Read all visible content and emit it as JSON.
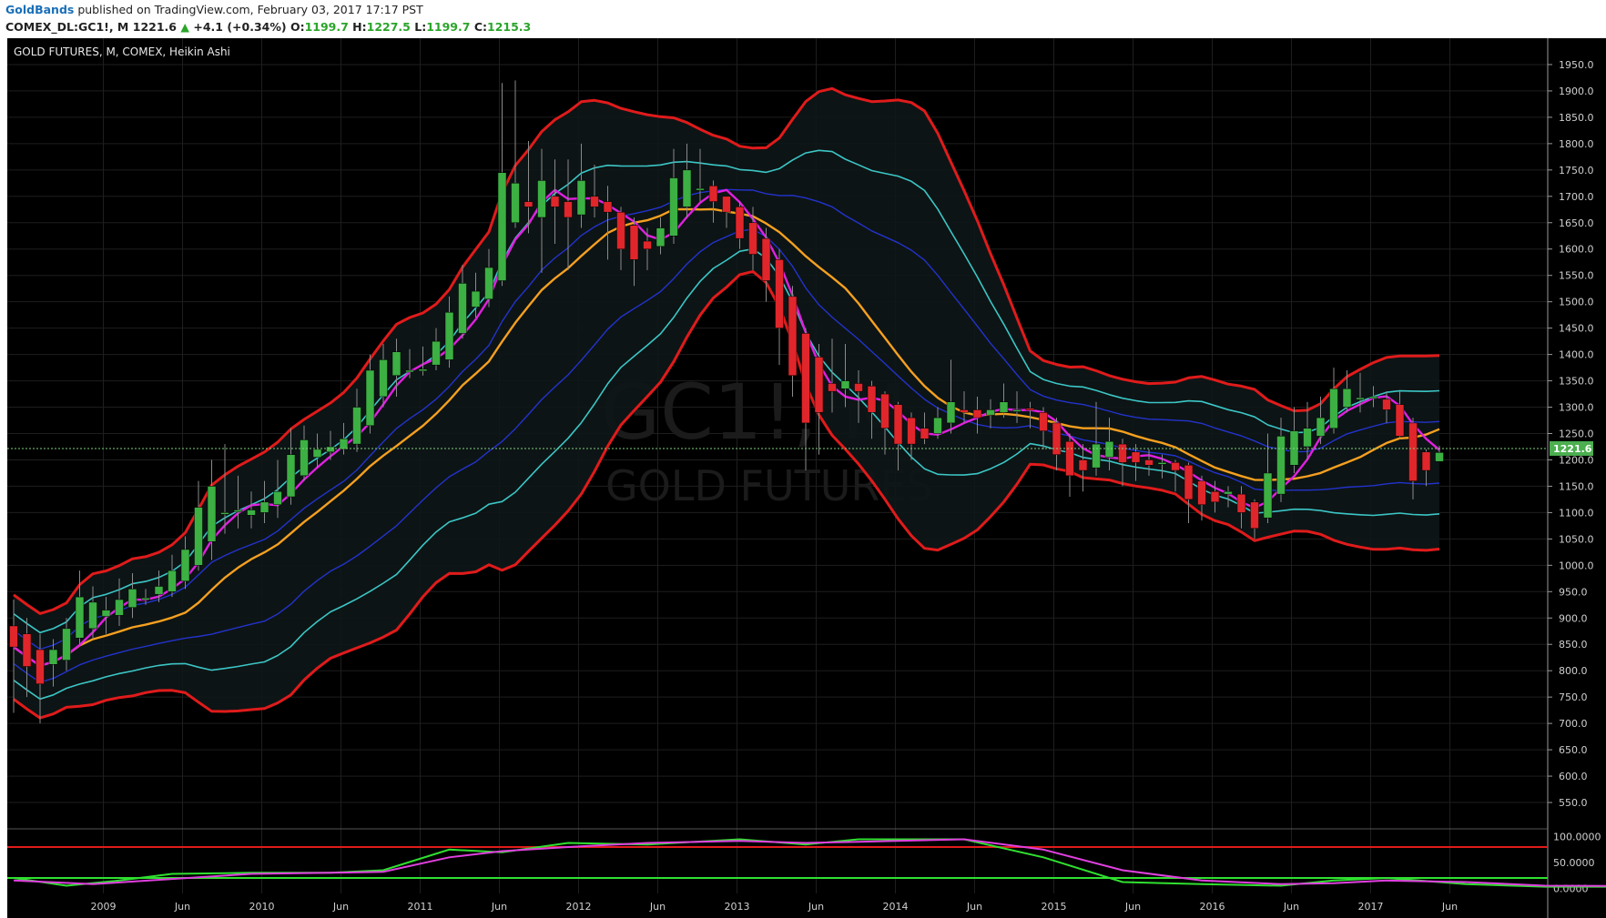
{
  "header": {
    "author": "GoldBands",
    "published": " published on TradingView.com, February 03, 2017 17:17 PST",
    "symbol": "COMEX_DL:GC1!, M",
    "last": "1221.6",
    "change": "+4.1 (+0.34%)",
    "o_label": "O:",
    "o": "1199.7",
    "h_label": "H:",
    "h": "1227.5",
    "l_label": "L:",
    "l": "1199.7",
    "c_label": "C:",
    "c": "1215.3"
  },
  "pane_title": "GOLD FUTURES, M, COMEX, Heikin Ashi",
  "watermark": {
    "line1": "GC1!, M",
    "line2": "GOLD FUTURES"
  },
  "price_label": "1221.6",
  "colors": {
    "up": "#3cb043",
    "down": "#e0262b",
    "background": "#000000",
    "band_outer": "#e01b1b",
    "band_mid": "#3cc6c6",
    "band_inner": "#2233cc",
    "ma_slow": "#f5a020",
    "ma_fast": "#e020e0",
    "osc_k": "#30e030",
    "osc_d": "#e040e0"
  },
  "chart_data": [
    {
      "type": "candlestick",
      "title": "GOLD FUTURES, M, COMEX, Heikin Ashi",
      "ylim": [
        500,
        2000
      ],
      "y_ticks": [
        "550.0",
        "600.0",
        "650.0",
        "700.0",
        "750.0",
        "800.0",
        "850.0",
        "900.0",
        "950.0",
        "1000.0",
        "1050.0",
        "1100.0",
        "1150.0",
        "1200.0",
        "1250.0",
        "1300.0",
        "1350.0",
        "1400.0",
        "1450.0",
        "1500.0",
        "1550.0",
        "1600.0",
        "1650.0",
        "1700.0",
        "1750.0",
        "1800.0",
        "1850.0",
        "1900.0",
        "1950.0"
      ],
      "x_ticks": [
        "2009",
        "Jun",
        "2010",
        "Jun",
        "2011",
        "Jun",
        "2012",
        "Jun",
        "2013",
        "Jun",
        "2014",
        "Jun",
        "2015",
        "Jun",
        "2016",
        "Jun",
        "2017",
        "Jun"
      ],
      "candles": [
        {
          "o": 885,
          "c": 845,
          "h": 935,
          "l": 720
        },
        {
          "o": 870,
          "c": 808,
          "h": 900,
          "l": 750
        },
        {
          "o": 840,
          "c": 775,
          "h": 870,
          "l": 700
        },
        {
          "o": 812,
          "c": 840,
          "h": 860,
          "l": 770
        },
        {
          "o": 820,
          "c": 880,
          "h": 900,
          "l": 800
        },
        {
          "o": 862,
          "c": 940,
          "h": 990,
          "l": 850
        },
        {
          "o": 880,
          "c": 930,
          "h": 960,
          "l": 860
        },
        {
          "o": 903,
          "c": 915,
          "h": 940,
          "l": 870
        },
        {
          "o": 905,
          "c": 935,
          "h": 975,
          "l": 885
        },
        {
          "o": 920,
          "c": 955,
          "h": 985,
          "l": 900
        },
        {
          "o": 938,
          "c": 938,
          "h": 955,
          "l": 925
        },
        {
          "o": 945,
          "c": 960,
          "h": 990,
          "l": 930
        },
        {
          "o": 950,
          "c": 990,
          "h": 1020,
          "l": 940
        },
        {
          "o": 970,
          "c": 1030,
          "h": 1055,
          "l": 955
        },
        {
          "o": 1000,
          "c": 1110,
          "h": 1160,
          "l": 990
        },
        {
          "o": 1045,
          "c": 1150,
          "h": 1200,
          "l": 1010
        },
        {
          "o": 1100,
          "c": 1100,
          "h": 1230,
          "l": 1060
        },
        {
          "o": 1102,
          "c": 1105,
          "h": 1170,
          "l": 1070
        },
        {
          "o": 1095,
          "c": 1105,
          "h": 1140,
          "l": 1070
        },
        {
          "o": 1100,
          "c": 1120,
          "h": 1160,
          "l": 1080
        },
        {
          "o": 1115,
          "c": 1140,
          "h": 1200,
          "l": 1090
        },
        {
          "o": 1130,
          "c": 1210,
          "h": 1260,
          "l": 1115
        },
        {
          "o": 1170,
          "c": 1238,
          "h": 1265,
          "l": 1160
        },
        {
          "o": 1205,
          "c": 1220,
          "h": 1250,
          "l": 1185
        },
        {
          "o": 1215,
          "c": 1225,
          "h": 1255,
          "l": 1200
        },
        {
          "o": 1220,
          "c": 1240,
          "h": 1270,
          "l": 1210
        },
        {
          "o": 1230,
          "c": 1300,
          "h": 1335,
          "l": 1215
        },
        {
          "o": 1265,
          "c": 1370,
          "h": 1400,
          "l": 1250
        },
        {
          "o": 1320,
          "c": 1390,
          "h": 1420,
          "l": 1300
        },
        {
          "o": 1360,
          "c": 1405,
          "h": 1430,
          "l": 1320
        },
        {
          "o": 1370,
          "c": 1370,
          "h": 1410,
          "l": 1355
        },
        {
          "o": 1372,
          "c": 1372,
          "h": 1415,
          "l": 1360
        },
        {
          "o": 1380,
          "c": 1425,
          "h": 1450,
          "l": 1370
        },
        {
          "o": 1390,
          "c": 1480,
          "h": 1510,
          "l": 1375
        },
        {
          "o": 1440,
          "c": 1535,
          "h": 1570,
          "l": 1430
        },
        {
          "o": 1490,
          "c": 1520,
          "h": 1555,
          "l": 1470
        },
        {
          "o": 1505,
          "c": 1565,
          "h": 1600,
          "l": 1490
        },
        {
          "o": 1540,
          "c": 1745,
          "h": 1915,
          "l": 1530
        },
        {
          "o": 1650,
          "c": 1725,
          "h": 1920,
          "l": 1640
        },
        {
          "o": 1690,
          "c": 1680,
          "h": 1805,
          "l": 1630
        },
        {
          "o": 1660,
          "c": 1730,
          "h": 1790,
          "l": 1555
        },
        {
          "o": 1700,
          "c": 1680,
          "h": 1770,
          "l": 1610
        },
        {
          "o": 1690,
          "c": 1660,
          "h": 1770,
          "l": 1560
        },
        {
          "o": 1665,
          "c": 1730,
          "h": 1800,
          "l": 1640
        },
        {
          "o": 1700,
          "c": 1680,
          "h": 1760,
          "l": 1660
        },
        {
          "o": 1690,
          "c": 1670,
          "h": 1720,
          "l": 1580
        },
        {
          "o": 1670,
          "c": 1600,
          "h": 1680,
          "l": 1560
        },
        {
          "o": 1645,
          "c": 1580,
          "h": 1660,
          "l": 1530
        },
        {
          "o": 1615,
          "c": 1600,
          "h": 1640,
          "l": 1560
        },
        {
          "o": 1605,
          "c": 1640,
          "h": 1660,
          "l": 1590
        },
        {
          "o": 1625,
          "c": 1735,
          "h": 1790,
          "l": 1610
        },
        {
          "o": 1680,
          "c": 1750,
          "h": 1800,
          "l": 1660
        },
        {
          "o": 1715,
          "c": 1715,
          "h": 1790,
          "l": 1690
        },
        {
          "o": 1720,
          "c": 1690,
          "h": 1730,
          "l": 1650
        },
        {
          "o": 1700,
          "c": 1670,
          "h": 1700,
          "l": 1640
        },
        {
          "o": 1680,
          "c": 1620,
          "h": 1690,
          "l": 1600
        },
        {
          "o": 1650,
          "c": 1590,
          "h": 1680,
          "l": 1560
        },
        {
          "o": 1620,
          "c": 1540,
          "h": 1640,
          "l": 1500
        },
        {
          "o": 1580,
          "c": 1450,
          "h": 1600,
          "l": 1380
        },
        {
          "o": 1510,
          "c": 1360,
          "h": 1530,
          "l": 1320
        },
        {
          "o": 1440,
          "c": 1270,
          "h": 1450,
          "l": 1180
        },
        {
          "o": 1395,
          "c": 1290,
          "h": 1420,
          "l": 1210
        },
        {
          "o": 1345,
          "c": 1330,
          "h": 1430,
          "l": 1290
        },
        {
          "o": 1335,
          "c": 1350,
          "h": 1420,
          "l": 1300
        },
        {
          "o": 1345,
          "c": 1330,
          "h": 1370,
          "l": 1270
        },
        {
          "o": 1340,
          "c": 1290,
          "h": 1350,
          "l": 1240
        },
        {
          "o": 1325,
          "c": 1260,
          "h": 1330,
          "l": 1210
        },
        {
          "o": 1305,
          "c": 1230,
          "h": 1310,
          "l": 1180
        },
        {
          "o": 1280,
          "c": 1230,
          "h": 1290,
          "l": 1200
        },
        {
          "o": 1260,
          "c": 1240,
          "h": 1290,
          "l": 1230
        },
        {
          "o": 1250,
          "c": 1280,
          "h": 1300,
          "l": 1240
        },
        {
          "o": 1270,
          "c": 1310,
          "h": 1390,
          "l": 1250
        },
        {
          "o": 1295,
          "c": 1290,
          "h": 1330,
          "l": 1270
        },
        {
          "o": 1295,
          "c": 1280,
          "h": 1320,
          "l": 1250
        },
        {
          "o": 1285,
          "c": 1295,
          "h": 1315,
          "l": 1260
        },
        {
          "o": 1290,
          "c": 1310,
          "h": 1345,
          "l": 1280
        },
        {
          "o": 1295,
          "c": 1295,
          "h": 1330,
          "l": 1270
        },
        {
          "o": 1298,
          "c": 1295,
          "h": 1310,
          "l": 1260
        },
        {
          "o": 1290,
          "c": 1255,
          "h": 1300,
          "l": 1220
        },
        {
          "o": 1270,
          "c": 1210,
          "h": 1280,
          "l": 1180
        },
        {
          "o": 1235,
          "c": 1170,
          "h": 1250,
          "l": 1130
        },
        {
          "o": 1200,
          "c": 1180,
          "h": 1230,
          "l": 1140
        },
        {
          "o": 1185,
          "c": 1230,
          "h": 1310,
          "l": 1170
        },
        {
          "o": 1205,
          "c": 1235,
          "h": 1280,
          "l": 1180
        },
        {
          "o": 1230,
          "c": 1195,
          "h": 1240,
          "l": 1150
        },
        {
          "o": 1215,
          "c": 1195,
          "h": 1230,
          "l": 1160
        },
        {
          "o": 1200,
          "c": 1190,
          "h": 1220,
          "l": 1170
        },
        {
          "o": 1195,
          "c": 1195,
          "h": 1210,
          "l": 1165
        },
        {
          "o": 1195,
          "c": 1180,
          "h": 1200,
          "l": 1140
        },
        {
          "o": 1190,
          "c": 1125,
          "h": 1195,
          "l": 1080
        },
        {
          "o": 1160,
          "c": 1115,
          "h": 1170,
          "l": 1085
        },
        {
          "o": 1140,
          "c": 1120,
          "h": 1160,
          "l": 1100
        },
        {
          "o": 1135,
          "c": 1140,
          "h": 1150,
          "l": 1110
        },
        {
          "o": 1135,
          "c": 1100,
          "h": 1150,
          "l": 1070
        },
        {
          "o": 1120,
          "c": 1070,
          "h": 1125,
          "l": 1050
        },
        {
          "o": 1090,
          "c": 1175,
          "h": 1250,
          "l": 1080
        },
        {
          "o": 1135,
          "c": 1245,
          "h": 1280,
          "l": 1120
        },
        {
          "o": 1190,
          "c": 1255,
          "h": 1300,
          "l": 1175
        },
        {
          "o": 1225,
          "c": 1260,
          "h": 1310,
          "l": 1200
        },
        {
          "o": 1245,
          "c": 1280,
          "h": 1320,
          "l": 1230
        },
        {
          "o": 1260,
          "c": 1335,
          "h": 1375,
          "l": 1250
        },
        {
          "o": 1300,
          "c": 1335,
          "h": 1370,
          "l": 1290
        },
        {
          "o": 1318,
          "c": 1318,
          "h": 1365,
          "l": 1290
        },
        {
          "o": 1320,
          "c": 1320,
          "h": 1340,
          "l": 1300
        },
        {
          "o": 1315,
          "c": 1295,
          "h": 1330,
          "l": 1270
        },
        {
          "o": 1305,
          "c": 1245,
          "h": 1330,
          "l": 1240
        },
        {
          "o": 1270,
          "c": 1160,
          "h": 1280,
          "l": 1125
        },
        {
          "o": 1215,
          "c": 1180,
          "h": 1220,
          "l": 1150
        },
        {
          "o": 1197,
          "c": 1214,
          "h": 1227,
          "l": 1197
        }
      ],
      "current_price": 1221.6
    },
    {
      "type": "line",
      "title": "",
      "ylim": [
        -10,
        110
      ],
      "y_ticks": [
        "0.0000",
        "50.0000",
        "100.0000"
      ],
      "levels": [
        80,
        20
      ],
      "series": [
        {
          "points": [
            [
              0,
              20
            ],
            [
              4,
              5
            ],
            [
              8,
              15
            ],
            [
              12,
              28
            ],
            [
              18,
              30
            ],
            [
              24,
              30
            ],
            [
              28,
              35
            ],
            [
              33,
              75
            ],
            [
              37,
              70
            ],
            [
              42,
              88
            ],
            [
              48,
              85
            ],
            [
              55,
              95
            ],
            [
              60,
              85
            ],
            [
              64,
              95
            ],
            [
              72,
              95
            ],
            [
              78,
              60
            ],
            [
              84,
              12
            ],
            [
              90,
              8
            ],
            [
              96,
              5
            ],
            [
              100,
              15
            ],
            [
              104,
              20
            ],
            [
              110,
              8
            ],
            [
              116,
              3
            ],
            [
              125,
              3
            ],
            [
              130,
              10
            ],
            [
              136,
              8
            ],
            [
              144,
              18
            ],
            [
              150,
              20
            ],
            [
              156,
              15
            ],
            [
              162,
              5
            ],
            [
              168,
              50
            ],
            [
              172,
              60
            ],
            [
              176,
              45
            ],
            [
              180,
              40
            ],
            [
              184,
              20
            ],
            [
              188,
              5
            ],
            [
              192,
              10
            ],
            [
              200,
              8
            ],
            [
              206,
              70
            ],
            [
              210,
              95
            ],
            [
              224,
              95
            ],
            [
              230,
              80
            ],
            [
              234,
              60
            ],
            [
              238,
              48
            ],
            [
              242,
              45
            ]
          ]
        },
        {
          "points": [
            [
              0,
              15
            ],
            [
              6,
              8
            ],
            [
              12,
              18
            ],
            [
              18,
              28
            ],
            [
              24,
              30
            ],
            [
              28,
              32
            ],
            [
              33,
              60
            ],
            [
              37,
              72
            ],
            [
              42,
              80
            ],
            [
              48,
              88
            ],
            [
              55,
              92
            ],
            [
              60,
              88
            ],
            [
              64,
              90
            ],
            [
              72,
              95
            ],
            [
              78,
              75
            ],
            [
              84,
              35
            ],
            [
              90,
              15
            ],
            [
              96,
              8
            ],
            [
              100,
              10
            ],
            [
              104,
              15
            ],
            [
              110,
              12
            ],
            [
              116,
              5
            ],
            [
              125,
              4
            ],
            [
              130,
              8
            ],
            [
              136,
              10
            ],
            [
              144,
              14
            ],
            [
              150,
              18
            ],
            [
              156,
              16
            ],
            [
              162,
              10
            ],
            [
              168,
              35
            ],
            [
              172,
              50
            ],
            [
              176,
              50
            ],
            [
              180,
              42
            ],
            [
              184,
              28
            ],
            [
              188,
              12
            ],
            [
              192,
              8
            ],
            [
              200,
              8
            ],
            [
              206,
              40
            ],
            [
              210,
              80
            ],
            [
              216,
              95
            ],
            [
              224,
              98
            ],
            [
              230,
              90
            ],
            [
              234,
              78
            ],
            [
              238,
              62
            ],
            [
              242,
              52
            ]
          ]
        }
      ]
    }
  ]
}
